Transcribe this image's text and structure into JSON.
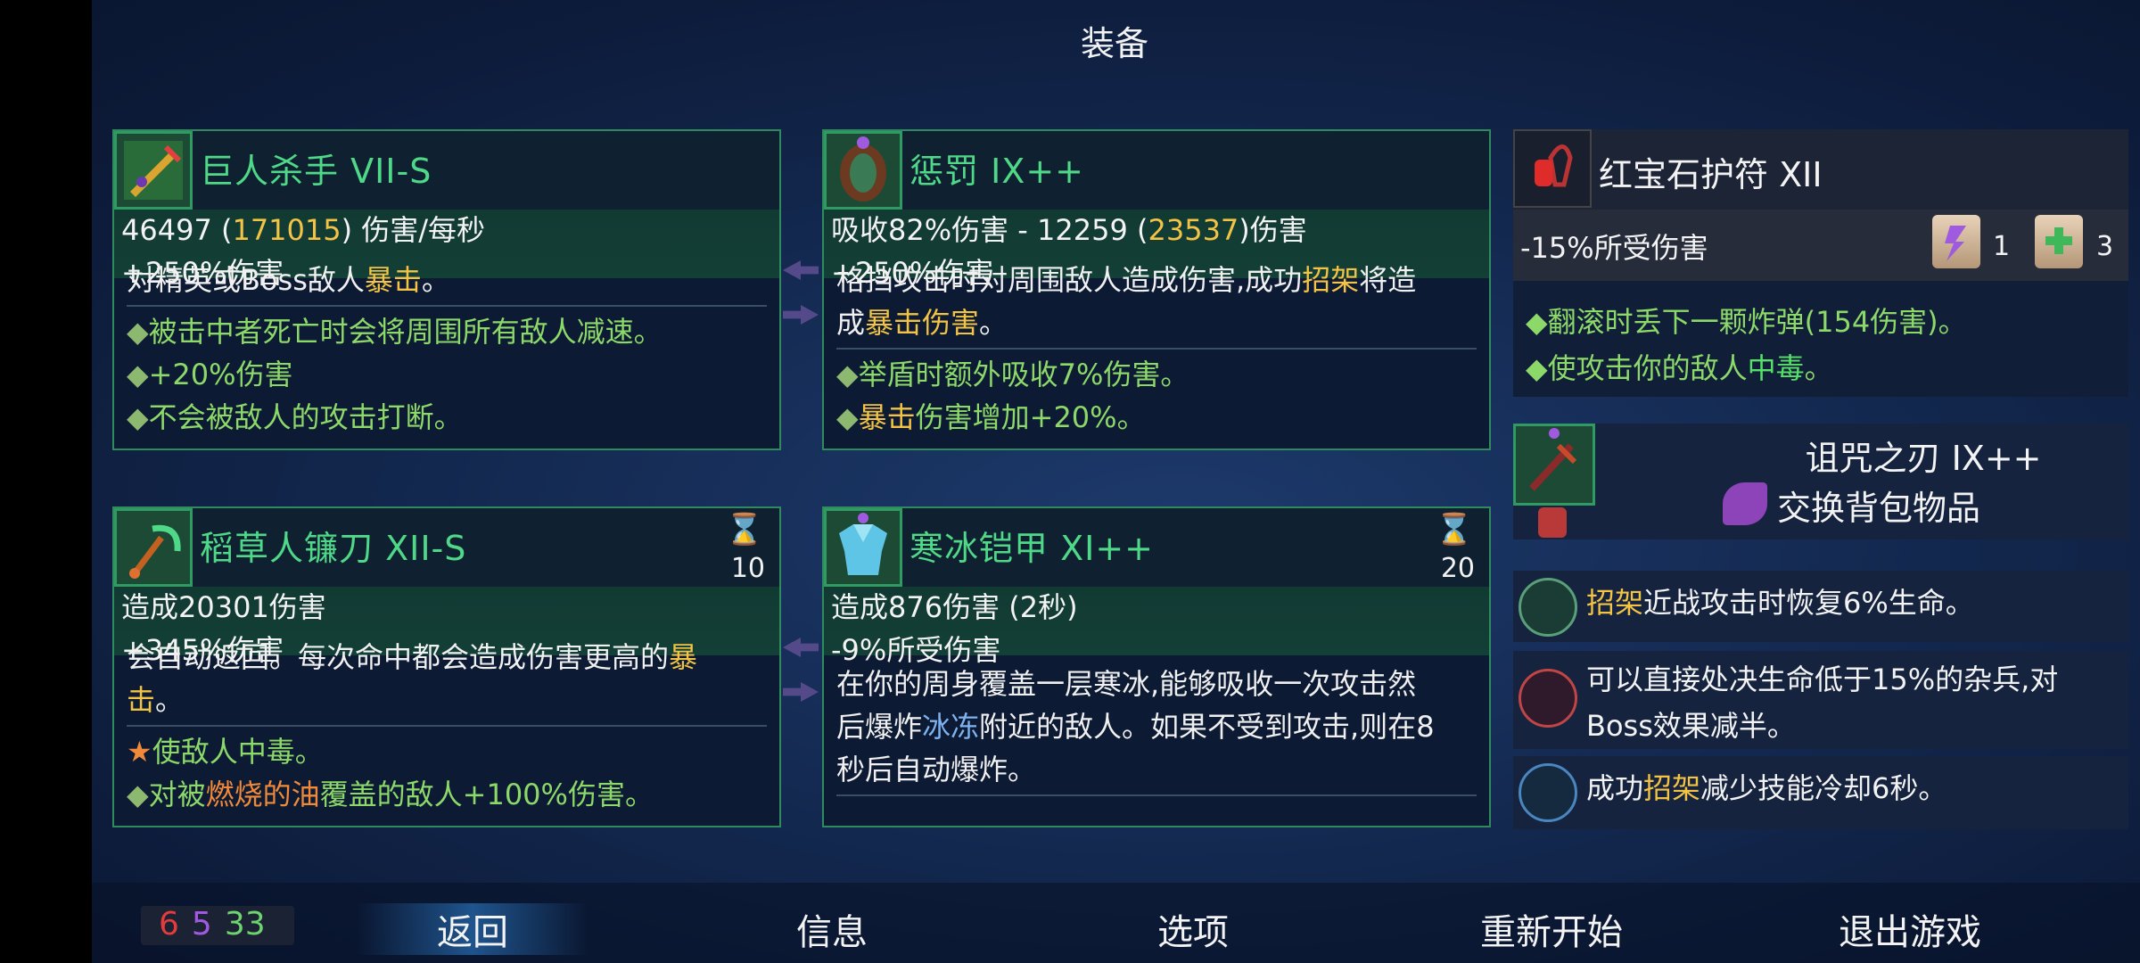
{
  "screen_title": "装备",
  "panels": {
    "p1": {
      "name": "巨人杀手 VII-S",
      "stat1_a": "46497 (",
      "stat1_b": "171015",
      "stat1_c": ") 伤害/每秒",
      "stat2": "+250%伤害",
      "clip_text_a": "对精英或Boss敌人",
      "clip_text_b": "暴击",
      "clip_text_c": "。",
      "line1": "被击中者死亡时会将周围所有敌人减速。",
      "line2": "+20%伤害",
      "line3": "不会被敌人的攻击打断。"
    },
    "p2": {
      "name": "惩罚 IX++",
      "stat1_a": "吸收82%伤害 - 12259 (",
      "stat1_b": "23537",
      "stat1_c": ")伤害",
      "stat2": "+250%伤害",
      "clip_a": "格挡攻击时对周围敌人造成伤害,成功",
      "clip_b": "招架",
      "clip_c": "将造",
      "line0_a": "成",
      "line0_b": "暴击伤害",
      "line0_c": "。",
      "line1": "举盾时额外吸收7%伤害。",
      "line2_a": "暴击",
      "line2_b": "伤害增加+20%。"
    },
    "p3": {
      "name": "稻草人镰刀 XII-S",
      "count": "10",
      "stat1": "造成20301伤害",
      "stat2": "+345%伤害",
      "clip_a": "会自动返回。每次命中都会造成伤害更高的",
      "clip_b": "暴",
      "line0": "击",
      "line0_end": "。",
      "line1_a": "使敌人",
      "line1_b": "中毒",
      "line1_c": "。",
      "line2_a": "对被",
      "line2_b": "燃烧的油",
      "line2_c": "覆盖的敌人+100%伤害。"
    },
    "p4": {
      "name": "寒冰铠甲 XI++",
      "count": "20",
      "stat1": "造成876伤害 (2秒)",
      "stat2": "-9%所受伤害",
      "line1": "在你的周身覆盖一层寒冰,能够吸收一次攻击然",
      "line2_a": "后爆炸",
      "line2_b": "冰冻",
      "line2_c": "附近的敌人。如果不受到攻击,则在8",
      "line3": "秒后自动爆炸。"
    }
  },
  "amulet": {
    "name": "红宝石护符 XII",
    "stat": "-15%所受伤害",
    "scroll1_count": "1",
    "scroll2_count": "3",
    "line1": "翻滚时丢下一颗炸弹(154伤害)。",
    "line2_a": "使攻击你的敌人",
    "line2_b": "中毒",
    "line2_c": "。"
  },
  "backpack": {
    "name": "诅咒之刃 IX++",
    "swap_label": "交换背包物品"
  },
  "mutations": {
    "m1_a": "招架",
    "m1_b": "近战攻击时恢复6%生命。",
    "m2": "可以直接处决生命低于15%的杂兵,对Boss效果减半。",
    "m3_a": "成功",
    "m3_b": "招架",
    "m3_c": "减少技能冷却6秒。"
  },
  "counts": {
    "red": "6",
    "purple": "5",
    "green": "33"
  },
  "menu": {
    "back": "返回",
    "info": "信息",
    "options": "选项",
    "restart": "重新开始",
    "quit": "退出游戏"
  },
  "colors": {
    "brutality": "#e53b3b",
    "tactics": "#a05ae0",
    "survival": "#6fd36f",
    "accent_green": "#4fd887",
    "gold": "#f2c344"
  },
  "icons": {
    "p1": "giant-killer-icon",
    "p2": "punishment-shield-icon",
    "p3": "scythe-icon",
    "p4": "ice-armor-icon",
    "amulet": "ruby-amulet-icon",
    "backpack": "cursed-sword-icon",
    "swap": "swap-hand-icon",
    "m1": "parry-mutation-icon",
    "m2": "execute-mutation-icon",
    "m3": "parry-cooldown-mutation-icon"
  }
}
